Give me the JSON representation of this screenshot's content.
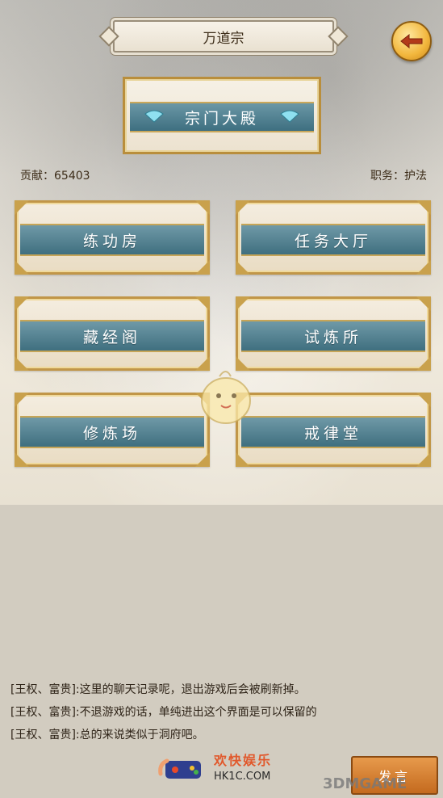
{
  "header": {
    "title": "万道宗",
    "back_icon": "back-arrow-icon"
  },
  "hall": {
    "label": "宗门大殿",
    "icon": "fan-icon"
  },
  "stats": {
    "contribution": "贡献：65403",
    "position": "职务：护法"
  },
  "buildings": [
    {
      "label": "练功房"
    },
    {
      "label": "任务大厅"
    },
    {
      "label": "藏经阁"
    },
    {
      "label": "试炼所"
    },
    {
      "label": "修炼场"
    },
    {
      "label": "戒律堂"
    }
  ],
  "chat": {
    "messages": [
      "[王权、富贵]:这里的聊天记录呢，退出游戏后会被刷新掉。",
      "[王权、富贵]:不退游戏的话，单纯进出这个界面是可以保留的",
      "[王权、富贵]:总的来说类似于洞府吧。"
    ],
    "send_label": "发言"
  },
  "watermark": {
    "title": "欢快娱乐",
    "sub": "HK1C.COM",
    "brand": "3DMGAME"
  },
  "colors": {
    "plate": "#3f6f7f",
    "gold": "#c19648",
    "button": "#c46a1e"
  }
}
